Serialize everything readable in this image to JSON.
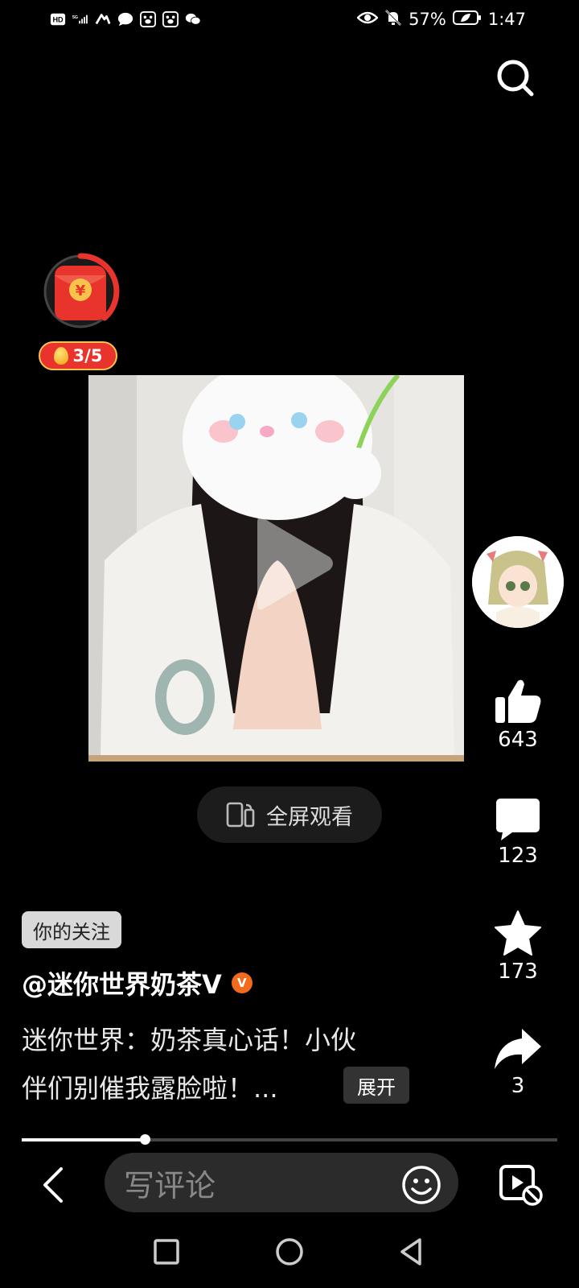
{
  "status_bar": {
    "battery": "57%",
    "time": "1:47",
    "left_icons": [
      "hd-icon",
      "5g-signal-icon",
      "hiking-app-icon",
      "message-icon",
      "baidu-paw-icon",
      "baidu-paw-icon",
      "wechat-icon"
    ],
    "right_icons": [
      "eye-icon",
      "bell-mute-icon",
      "battery-icon"
    ]
  },
  "header": {
    "search_icon": "search-icon"
  },
  "red_envelope": {
    "counter": "3/5",
    "icon": "red-envelope-icon"
  },
  "video": {
    "play_icon": "play-icon"
  },
  "fullscreen": {
    "label": "全屏观看",
    "icon": "fullscreen-rotate-icon"
  },
  "sidebar": {
    "avatar_icon": "anime-avatar",
    "like_count": "643",
    "comment_count": "123",
    "favorite_count": "173",
    "share_count": "3"
  },
  "post": {
    "follow_tag": "你的关注",
    "author": "@迷你世界奶茶V",
    "desc_line1": "迷你世界：奶茶真心话！小伙",
    "desc_line2": "伴们别催我露脸啦！...",
    "expand_label": "展开"
  },
  "progress": {
    "fraction": 0.23
  },
  "bottom_bar": {
    "comment_placeholder": "写评论"
  },
  "colors": {
    "accent_red": "#e8342c",
    "gold": "#f7c44b",
    "verified_orange": "#f26a1b"
  }
}
